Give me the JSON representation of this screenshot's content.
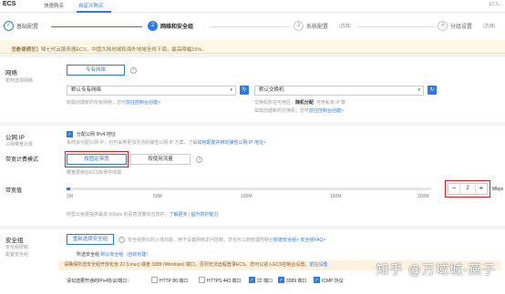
{
  "header": {
    "title": "ECS",
    "tab_quick": "快速购买",
    "tab_custom": "自定义购买",
    "right_text": "ECS..."
  },
  "steps": [
    {
      "num": "✓",
      "label": "基础配置",
      "state": "done"
    },
    {
      "num": "2",
      "label": "网络和安全组",
      "state": "active"
    },
    {
      "num": "3",
      "label": "系统配置",
      "hint": "(选填)",
      "state": "todo"
    },
    {
      "num": "4",
      "label": "分组设置",
      "hint": "(选填)",
      "state": "todo"
    }
  ],
  "notice": {
    "text": "【价格调整】降七代云服务器ECS，中国大陆地域和海外地域全线下调，最高降幅15%。",
    "link": "查看详情"
  },
  "network": {
    "label": "网络",
    "sub": "如何选择网络",
    "type_button": "专有网络",
    "vpc_select": "默认专有网络",
    "vswitch_select": "默认交换机",
    "vpc_hint": "如需创建新的专有网络，您可",
    "vpc_hint_link": "前往控制台创建>",
    "vswitch_zone_label": "交换机所在可用区：",
    "vswitch_zone": "随机分配",
    "vswitch_ip_label": "可用私有 IP 数",
    "vswitch_hint": "如需创建新的交换机，您可",
    "vswitch_hint_link": "前往控制台创建>"
  },
  "public_ip": {
    "label": "公网 IP",
    "sub": "公网带宽计费",
    "checkbox_label": "分配公网 IPv4 地址",
    "hint": "系统会分配公网 IP，也可采用更加灵活的弹性公网 IP 方案，了解",
    "hint_link": "如何配置并绑定弹性公网 IP 地址>",
    "billing_label": "带宽计费模式",
    "billing_options": [
      "按固定带宽",
      "按使用流量"
    ],
    "billing_hint": "带宽费用在ECS实例中收取",
    "bw_label": "带宽值",
    "bw_ticks": [
      "1M",
      "50M",
      "100M",
      "150M",
      "200M"
    ],
    "bw_value": "2",
    "bw_unit": "Mbps",
    "bw_fraction": 0.01,
    "bw_hint": "阿里云免费提供最高 5Gbps 的恶意流量攻击防护，",
    "bw_hint_link": "了解更多",
    "bw_hint_link2": "提升防护能力"
  },
  "security": {
    "label": "安全组",
    "sub1": "安全组限制",
    "sub2": "配置安全组",
    "button": "重新选择安全组",
    "hint": "安全组类似防火墙功能，用于设置网络访问控制，您也可以到管理控制台",
    "hint_link": "新建安全组>",
    "hint_link2": "安全组FAQ>",
    "selected_label": "所选安全组",
    "selected_value": "默认安全组（自动创建）",
    "warn": "请确保所选安全组开放包含 22 (Linux) 或者 3389 (Windows) 端口，否则无法远程登录ECS。您可以进入ECS控制台设置。",
    "warn_link": "前往设置",
    "ports_label": "请勾选要开通的IPv4协议/端口：",
    "ports": [
      {
        "label": "HTTP 80 端口",
        "checked": false
      },
      {
        "label": "HTTPS 443 端口",
        "checked": false
      },
      {
        "label": "22 端口",
        "checked": true
      },
      {
        "label": "3389 端口",
        "checked": true
      },
      {
        "label": "ICMP 协议",
        "checked": true
      }
    ]
  },
  "watermark": "知乎 @万域城-燕子"
}
